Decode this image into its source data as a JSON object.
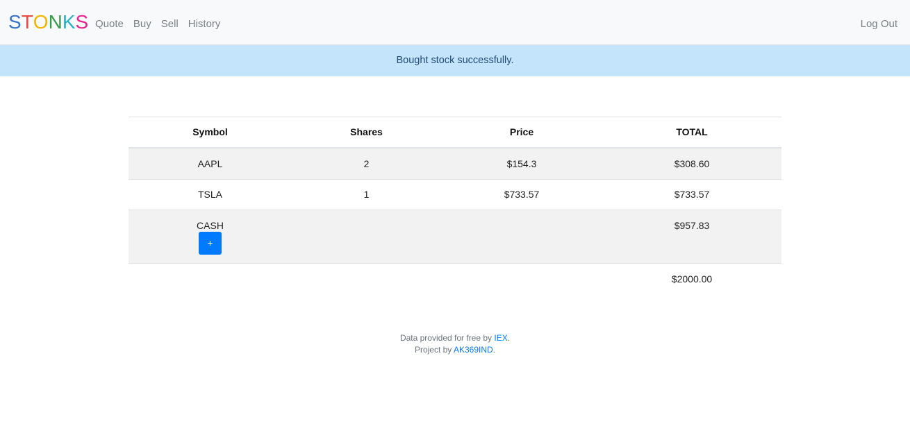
{
  "navbar": {
    "brand_letters": [
      {
        "char": "S",
        "color": "#3a75c4"
      },
      {
        "char": "T",
        "color": "#e84c3d"
      },
      {
        "char": "O",
        "color": "#f4b400"
      },
      {
        "char": "N",
        "color": "#3a9b4a"
      },
      {
        "char": "K",
        "color": "#2ab0c5"
      },
      {
        "char": "S",
        "color": "#e8238b"
      }
    ],
    "links": [
      "Quote",
      "Buy",
      "Sell",
      "History"
    ],
    "logout_label": "Log Out"
  },
  "alert": {
    "message": "Bought stock successfully.",
    "color": "#c4e4fb"
  },
  "table": {
    "headers": [
      "Symbol",
      "Shares",
      "Price",
      "TOTAL"
    ],
    "rows": [
      {
        "symbol": "AAPL",
        "shares": "2",
        "price": "$154.3",
        "total": "$308.60"
      },
      {
        "symbol": "TSLA",
        "shares": "1",
        "price": "$733.57",
        "total": "$733.57"
      }
    ],
    "cash": {
      "label": "CASH",
      "total": "$957.83",
      "add_button_label": "+"
    },
    "grand_total": "$2000.00"
  },
  "footer": {
    "line1_prefix": "Data provided for free by ",
    "line1_link": "IEX",
    "line1_suffix": ".",
    "line2_prefix": "Project by ",
    "line2_link": "AK369IND",
    "line2_suffix": "."
  },
  "colors": {
    "accent": "#007bff",
    "navbar_bg": "#f8f9fa"
  }
}
